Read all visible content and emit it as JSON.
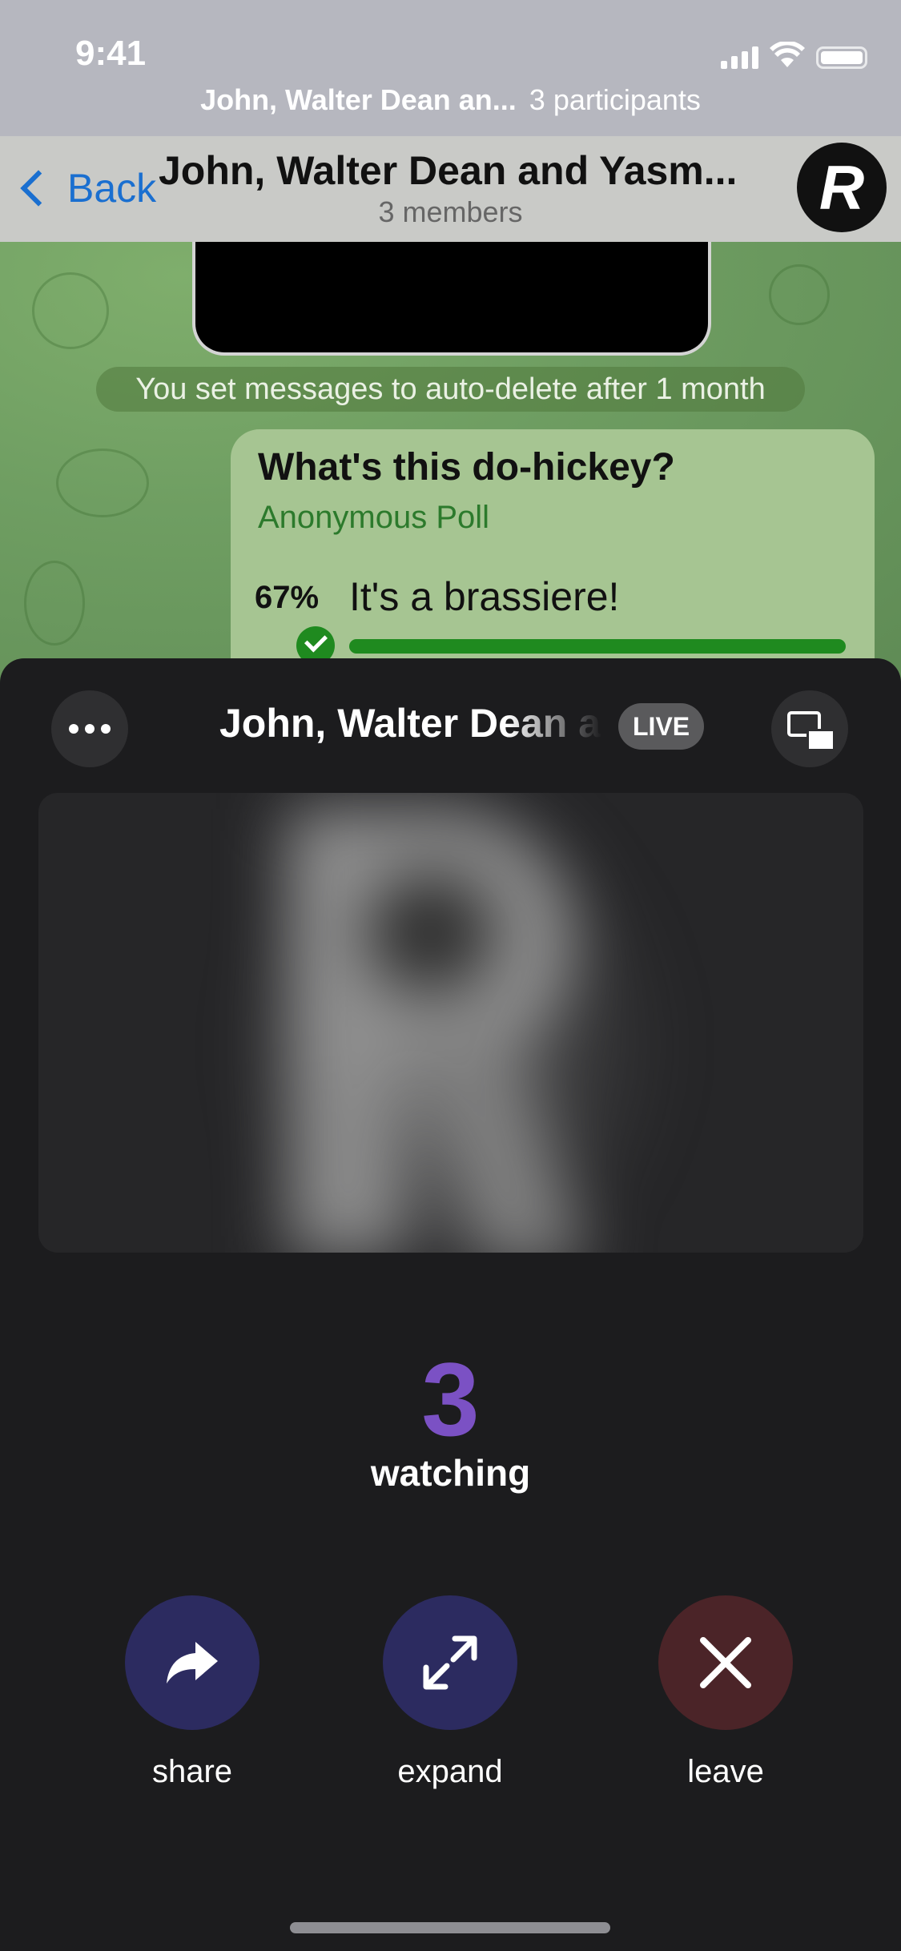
{
  "status_bar": {
    "time": "9:41"
  },
  "call_strip": {
    "title": "John, Walter Dean an...",
    "participants": "3 participants"
  },
  "nav": {
    "back_label": "Back",
    "title": "John, Walter Dean and Yasm...",
    "subtitle": "3 members",
    "avatar_letter": "R"
  },
  "chat": {
    "system_message": "You set messages to auto-delete after 1 month",
    "poll": {
      "question": "What's this do-hickey?",
      "type": "Anonymous Poll",
      "option_percent": "67%",
      "option_text": "It's a brassiere!",
      "option_fraction": 0.67
    }
  },
  "sheet": {
    "title": "John, Walter Dean and Yasmin",
    "live_badge": "LIVE",
    "watching_count": "3",
    "watching_label": "watching",
    "actions": {
      "share": "share",
      "expand": "expand",
      "leave": "leave"
    }
  },
  "colors": {
    "accent_purple": "#7b51c4",
    "action_blue": "#2c2b60",
    "leave_red": "#4b2428",
    "poll_green": "#1f8a1f"
  },
  "icons": [
    "signal-icon",
    "wifi-icon",
    "battery-icon",
    "chevron-left-icon",
    "more-icon",
    "pip-icon",
    "share-icon",
    "expand-icon",
    "close-icon",
    "check-icon"
  ]
}
